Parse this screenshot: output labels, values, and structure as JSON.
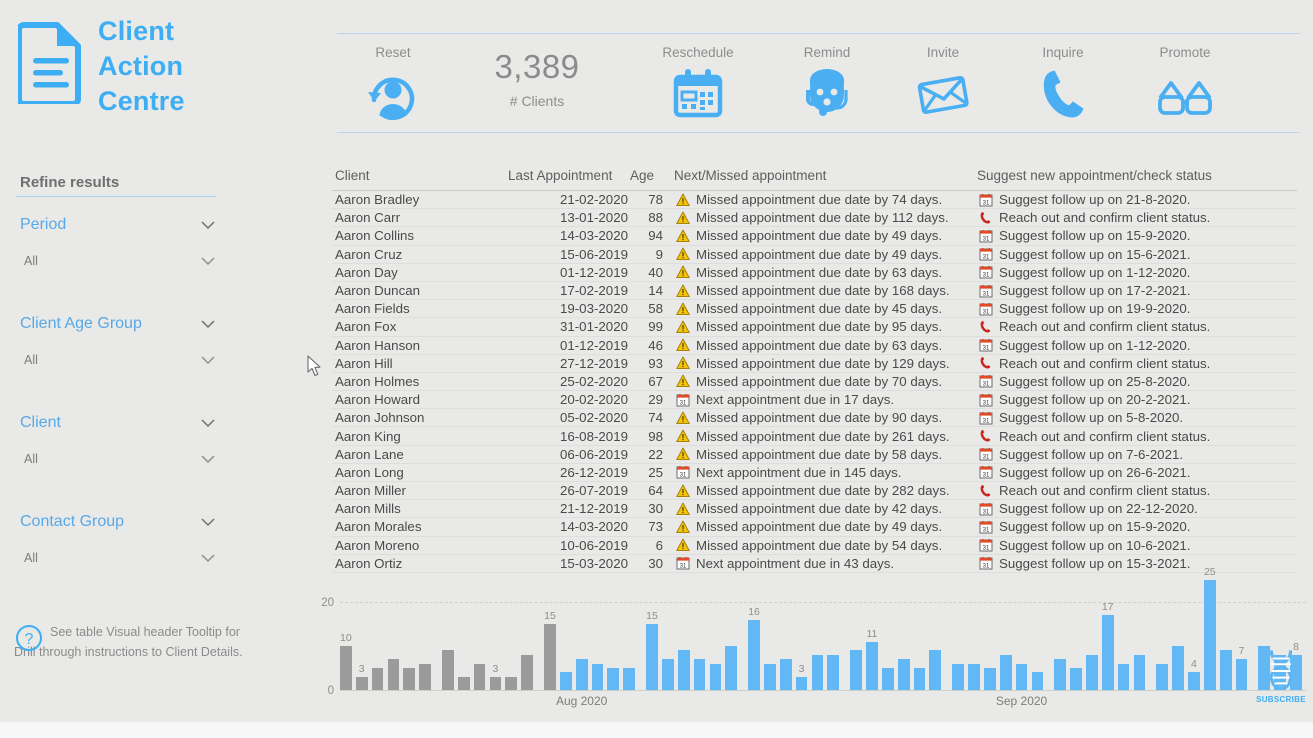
{
  "brand": {
    "line1": "Client",
    "line2": "Action",
    "line3": "Centre",
    "icon": "document-icon",
    "color": "#3daef4"
  },
  "toolbar": {
    "items": [
      {
        "label": "Reset",
        "icon": "reset-client-icon"
      },
      {
        "label": "Reschedule",
        "icon": "calendar-icon"
      },
      {
        "label": "Remind",
        "icon": "headset-agent-icon"
      },
      {
        "label": "Invite",
        "icon": "envelope-icon"
      },
      {
        "label": "Inquire",
        "icon": "phone-icon"
      },
      {
        "label": "Promote",
        "icon": "glasses-icon"
      }
    ],
    "kpi_value": "3,389",
    "kpi_label": "# Clients"
  },
  "sidebar": {
    "title": "Refine results",
    "filters": [
      {
        "title": "Period",
        "value": "All"
      },
      {
        "title": "Client Age Group",
        "value": "All"
      },
      {
        "title": "Client",
        "value": "All"
      },
      {
        "title": "Contact Group",
        "value": "All"
      }
    ],
    "help_icon": "question-mark-icon",
    "help_text": "See table Visual header Tooltip for Drill through instructions to Client Details."
  },
  "table": {
    "columns": [
      "Client",
      "Last Appointment",
      "Age",
      "Next/Missed appointment",
      "Suggest new appointment/check status"
    ],
    "rows": [
      {
        "client": "Aaron Bradley",
        "date": "21-02-2020",
        "age": "78",
        "next_icon": "warning-icon",
        "next": "Missed appointment due date by 74 days.",
        "sug_icon": "calendar-icon",
        "sug": "Suggest follow up on 21-8-2020."
      },
      {
        "client": "Aaron Carr",
        "date": "13-01-2020",
        "age": "88",
        "next_icon": "warning-icon",
        "next": "Missed appointment due date by 112 days.",
        "sug_icon": "phone-icon",
        "sug": "Reach out and confirm client status."
      },
      {
        "client": "Aaron Collins",
        "date": "14-03-2020",
        "age": "94",
        "next_icon": "warning-icon",
        "next": "Missed appointment due date by 49 days.",
        "sug_icon": "calendar-icon",
        "sug": "Suggest follow up on 15-9-2020."
      },
      {
        "client": "Aaron Cruz",
        "date": "15-06-2019",
        "age": "9",
        "next_icon": "warning-icon",
        "next": "Missed appointment due date by 49 days.",
        "sug_icon": "calendar-icon",
        "sug": "Suggest follow up on 15-6-2021."
      },
      {
        "client": "Aaron Day",
        "date": "01-12-2019",
        "age": "40",
        "next_icon": "warning-icon",
        "next": "Missed appointment due date by 63 days.",
        "sug_icon": "calendar-icon",
        "sug": "Suggest follow up on 1-12-2020."
      },
      {
        "client": "Aaron Duncan",
        "date": "17-02-2019",
        "age": "14",
        "next_icon": "warning-icon",
        "next": "Missed appointment due date by 168 days.",
        "sug_icon": "calendar-icon",
        "sug": "Suggest follow up on 17-2-2021."
      },
      {
        "client": "Aaron Fields",
        "date": "19-03-2020",
        "age": "58",
        "next_icon": "warning-icon",
        "next": "Missed appointment due date by 45 days.",
        "sug_icon": "calendar-icon",
        "sug": "Suggest follow up on 19-9-2020."
      },
      {
        "client": "Aaron Fox",
        "date": "31-01-2020",
        "age": "99",
        "next_icon": "warning-icon",
        "next": "Missed appointment due date by 95 days.",
        "sug_icon": "phone-icon",
        "sug": "Reach out and confirm client status."
      },
      {
        "client": "Aaron Hanson",
        "date": "01-12-2019",
        "age": "46",
        "next_icon": "warning-icon",
        "next": "Missed appointment due date by 63 days.",
        "sug_icon": "calendar-icon",
        "sug": "Suggest follow up on 1-12-2020."
      },
      {
        "client": "Aaron Hill",
        "date": "27-12-2019",
        "age": "93",
        "next_icon": "warning-icon",
        "next": "Missed appointment due date by 129 days.",
        "sug_icon": "phone-icon",
        "sug": "Reach out and confirm client status."
      },
      {
        "client": "Aaron Holmes",
        "date": "25-02-2020",
        "age": "67",
        "next_icon": "warning-icon",
        "next": "Missed appointment due date by 70 days.",
        "sug_icon": "calendar-icon",
        "sug": "Suggest follow up on 25-8-2020."
      },
      {
        "client": "Aaron Howard",
        "date": "20-02-2020",
        "age": "29",
        "next_icon": "calendar-icon",
        "next": "Next appointment due in 17 days.",
        "sug_icon": "calendar-icon",
        "sug": "Suggest follow up on 20-2-2021."
      },
      {
        "client": "Aaron Johnson",
        "date": "05-02-2020",
        "age": "74",
        "next_icon": "warning-icon",
        "next": "Missed appointment due date by 90 days.",
        "sug_icon": "calendar-icon",
        "sug": "Suggest follow up on 5-8-2020."
      },
      {
        "client": "Aaron King",
        "date": "16-08-2019",
        "age": "98",
        "next_icon": "warning-icon",
        "next": "Missed appointment due date by 261 days.",
        "sug_icon": "phone-icon",
        "sug": "Reach out and confirm client status."
      },
      {
        "client": "Aaron Lane",
        "date": "06-06-2019",
        "age": "22",
        "next_icon": "warning-icon",
        "next": "Missed appointment due date by 58 days.",
        "sug_icon": "calendar-icon",
        "sug": "Suggest follow up on 7-6-2021."
      },
      {
        "client": "Aaron Long",
        "date": "26-12-2019",
        "age": "25",
        "next_icon": "calendar-icon",
        "next": "Next appointment due in 145 days.",
        "sug_icon": "calendar-icon",
        "sug": "Suggest follow up on 26-6-2021."
      },
      {
        "client": "Aaron Miller",
        "date": "26-07-2019",
        "age": "64",
        "next_icon": "warning-icon",
        "next": "Missed appointment due date by 282 days.",
        "sug_icon": "phone-icon",
        "sug": "Reach out and confirm client status."
      },
      {
        "client": "Aaron Mills",
        "date": "21-12-2019",
        "age": "30",
        "next_icon": "warning-icon",
        "next": "Missed appointment due date by 42 days.",
        "sug_icon": "calendar-icon",
        "sug": "Suggest follow up on 22-12-2020."
      },
      {
        "client": "Aaron Morales",
        "date": "14-03-2020",
        "age": "73",
        "next_icon": "warning-icon",
        "next": "Missed appointment due date by 49 days.",
        "sug_icon": "calendar-icon",
        "sug": "Suggest follow up on 15-9-2020."
      },
      {
        "client": "Aaron Moreno",
        "date": "10-06-2019",
        "age": "6",
        "next_icon": "warning-icon",
        "next": "Missed appointment due date by 54 days.",
        "sug_icon": "calendar-icon",
        "sug": "Suggest follow up on 10-6-2021."
      },
      {
        "client": "Aaron Ortiz",
        "date": "15-03-2020",
        "age": "30",
        "next_icon": "calendar-icon",
        "next": "Next appointment due in 43 days.",
        "sug_icon": "calendar-icon",
        "sug": "Suggest follow up on 15-3-2021."
      }
    ]
  },
  "watermark": {
    "icon": "dna-icon",
    "label": "SUBSCRIBE"
  },
  "chart_data": {
    "type": "bar",
    "title": "",
    "xlabel": "",
    "ylabel": "",
    "ylim": [
      0,
      20
    ],
    "yticks": [
      0,
      20
    ],
    "ytick_labels": [
      "0",
      "20"
    ],
    "grid": true,
    "colors": {
      "past": "#9b9b9b",
      "future": "#62b8f5"
    },
    "xtick_labels": [
      "Aug 2020",
      "Sep 2020"
    ],
    "xtick_positions": [
      14,
      40
    ],
    "groups_of": 6,
    "bars": [
      {
        "v": 10,
        "c": "past",
        "label": "10"
      },
      {
        "v": 3,
        "c": "past",
        "label": "3"
      },
      {
        "v": 5,
        "c": "past",
        "label": ""
      },
      {
        "v": 7,
        "c": "past",
        "label": ""
      },
      {
        "v": 5,
        "c": "past",
        "label": ""
      },
      {
        "v": 6,
        "c": "past",
        "label": ""
      },
      {
        "v": 9,
        "c": "past",
        "label": ""
      },
      {
        "v": 3,
        "c": "past",
        "label": ""
      },
      {
        "v": 6,
        "c": "past",
        "label": ""
      },
      {
        "v": 3,
        "c": "past",
        "label": "3"
      },
      {
        "v": 3,
        "c": "past",
        "label": ""
      },
      {
        "v": 8,
        "c": "past",
        "label": ""
      },
      {
        "v": 15,
        "c": "past",
        "label": "15"
      },
      {
        "v": 4,
        "c": "future",
        "label": ""
      },
      {
        "v": 7,
        "c": "future",
        "label": ""
      },
      {
        "v": 6,
        "c": "future",
        "label": ""
      },
      {
        "v": 5,
        "c": "future",
        "label": ""
      },
      {
        "v": 5,
        "c": "future",
        "label": ""
      },
      {
        "v": 15,
        "c": "future",
        "label": "15"
      },
      {
        "v": 7,
        "c": "future",
        "label": ""
      },
      {
        "v": 9,
        "c": "future",
        "label": ""
      },
      {
        "v": 7,
        "c": "future",
        "label": ""
      },
      {
        "v": 6,
        "c": "future",
        "label": ""
      },
      {
        "v": 10,
        "c": "future",
        "label": ""
      },
      {
        "v": 16,
        "c": "future",
        "label": "16"
      },
      {
        "v": 6,
        "c": "future",
        "label": ""
      },
      {
        "v": 7,
        "c": "future",
        "label": ""
      },
      {
        "v": 3,
        "c": "future",
        "label": "3"
      },
      {
        "v": 8,
        "c": "future",
        "label": ""
      },
      {
        "v": 8,
        "c": "future",
        "label": ""
      },
      {
        "v": 9,
        "c": "future",
        "label": ""
      },
      {
        "v": 11,
        "c": "future",
        "label": "11"
      },
      {
        "v": 5,
        "c": "future",
        "label": ""
      },
      {
        "v": 7,
        "c": "future",
        "label": ""
      },
      {
        "v": 5,
        "c": "future",
        "label": ""
      },
      {
        "v": 9,
        "c": "future",
        "label": ""
      },
      {
        "v": 6,
        "c": "future",
        "label": ""
      },
      {
        "v": 6,
        "c": "future",
        "label": ""
      },
      {
        "v": 5,
        "c": "future",
        "label": ""
      },
      {
        "v": 8,
        "c": "future",
        "label": ""
      },
      {
        "v": 6,
        "c": "future",
        "label": ""
      },
      {
        "v": 4,
        "c": "future",
        "label": ""
      },
      {
        "v": 7,
        "c": "future",
        "label": ""
      },
      {
        "v": 5,
        "c": "future",
        "label": ""
      },
      {
        "v": 8,
        "c": "future",
        "label": ""
      },
      {
        "v": 17,
        "c": "future",
        "label": "17"
      },
      {
        "v": 6,
        "c": "future",
        "label": ""
      },
      {
        "v": 8,
        "c": "future",
        "label": ""
      },
      {
        "v": 6,
        "c": "future",
        "label": ""
      },
      {
        "v": 10,
        "c": "future",
        "label": ""
      },
      {
        "v": 4,
        "c": "future",
        "label": "4"
      },
      {
        "v": 25,
        "c": "future",
        "label": "25"
      },
      {
        "v": 9,
        "c": "future",
        "label": ""
      },
      {
        "v": 7,
        "c": "future",
        "label": "7"
      },
      {
        "v": 10,
        "c": "future",
        "label": ""
      },
      {
        "v": 8,
        "c": "future",
        "label": ""
      },
      {
        "v": 8,
        "c": "future",
        "label": "8"
      }
    ]
  }
}
